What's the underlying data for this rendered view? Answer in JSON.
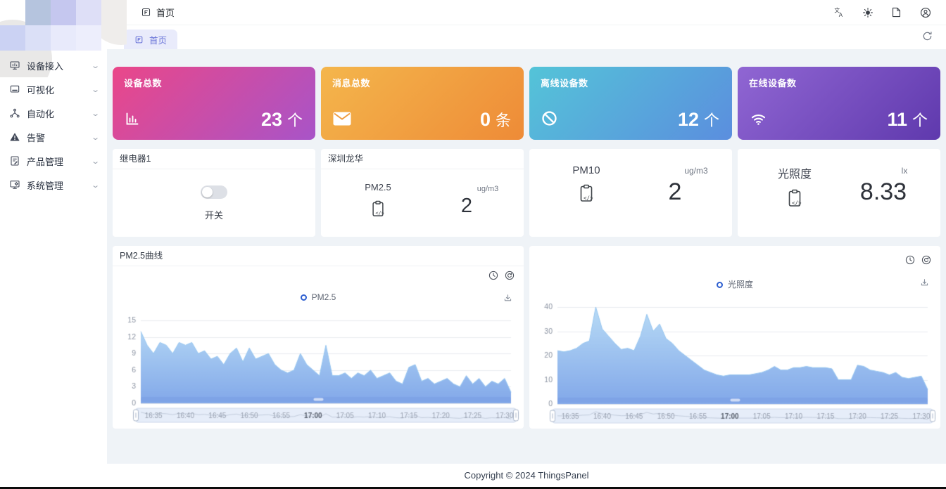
{
  "header": {
    "breadcrumb_label": "首页"
  },
  "tabbar": {
    "active_tab_label": "首页"
  },
  "sidebar": {
    "items": [
      {
        "label": "设备接入",
        "icon": "device-access-icon"
      },
      {
        "label": "可视化",
        "icon": "visualization-icon"
      },
      {
        "label": "自动化",
        "icon": "automation-icon"
      },
      {
        "label": "告警",
        "icon": "alarm-icon"
      },
      {
        "label": "产品管理",
        "icon": "product-management-icon"
      },
      {
        "label": "系统管理",
        "icon": "system-management-icon"
      }
    ]
  },
  "stats": [
    {
      "title": "设备总数",
      "value": "23",
      "unit": "个",
      "icon": "bar-chart-icon",
      "gradient": [
        "#ea4789",
        "#a854c8"
      ]
    },
    {
      "title": "消息总数",
      "value": "0",
      "unit": "条",
      "icon": "mail-icon",
      "gradient": [
        "#f4b64c",
        "#ee8b37"
      ]
    },
    {
      "title": "离线设备数",
      "value": "12",
      "unit": "个",
      "icon": "ban-icon",
      "gradient": [
        "#54c4d8",
        "#5b8ede"
      ]
    },
    {
      "title": "在线设备数",
      "value": "11",
      "unit": "个",
      "icon": "wifi-icon",
      "gradient": [
        "#9066d3",
        "#5f39ad"
      ]
    }
  ],
  "widgets": {
    "relay": {
      "title": "继电器1",
      "switch_label": "开关",
      "switch_on": false
    },
    "shenzhen": {
      "title": "深圳龙华",
      "metric": "PM2.5",
      "value": "2",
      "unit": "ug/m3"
    },
    "pm10": {
      "metric": "PM10",
      "value": "2",
      "unit": "ug/m3"
    },
    "illuminance": {
      "metric": "光照度",
      "value": "8.33",
      "unit": "lx"
    }
  },
  "chart_data": [
    {
      "type": "area",
      "title": "PM2.5曲线",
      "legend": "PM2.5",
      "legend_position": "top-center",
      "unit": "ug/m3",
      "grid": true,
      "x_start": "16:33",
      "x_end": "17:31",
      "x_ticks": [
        "16:35",
        "16:40",
        "16:45",
        "16:50",
        "16:55",
        "17:00",
        "17:05",
        "17:10",
        "17:15",
        "17:20",
        "17:25",
        "17:30"
      ],
      "bold_tick": "17:00",
      "ylim": [
        0,
        15
      ],
      "yticks": [
        0,
        3,
        6,
        9,
        12,
        15
      ],
      "values": [
        13,
        10.5,
        9,
        11,
        10.5,
        9,
        11,
        10.5,
        11,
        9,
        9.5,
        8,
        8.5,
        7,
        9,
        10,
        7.5,
        10,
        8,
        8.5,
        9,
        7,
        6,
        5.5,
        6,
        9,
        7,
        6,
        5,
        10.5,
        5,
        5,
        5.5,
        4.5,
        5.5,
        5,
        6,
        4.5,
        5,
        5.5,
        4,
        3.5,
        6.5,
        7,
        4,
        4.5,
        3.5,
        4,
        4.5,
        3.5,
        3,
        5,
        3.5,
        4.5,
        3,
        4,
        3.5,
        4.5,
        2
      ],
      "colors": {
        "area_top": "#b8dbf6",
        "area_bottom": "#82a8e9",
        "line": "#93c4ef",
        "band": "#7ea3e6"
      }
    },
    {
      "type": "area",
      "title": "",
      "legend": "光照度",
      "legend_position": "top-center",
      "unit": "lx",
      "grid": true,
      "x_start": "16:33",
      "x_end": "17:31",
      "x_ticks": [
        "16:35",
        "16:40",
        "16:45",
        "16:50",
        "16:55",
        "17:00",
        "17:05",
        "17:10",
        "17:15",
        "17:20",
        "17:25",
        "17:30"
      ],
      "bold_tick": "17:00",
      "ylim": [
        0,
        40
      ],
      "yticks": [
        0,
        10,
        20,
        30,
        40
      ],
      "values": [
        22,
        21.5,
        22,
        23,
        25,
        26,
        40,
        31,
        28,
        25,
        22.5,
        23,
        22,
        28,
        37,
        30,
        33,
        27,
        25,
        22,
        20,
        18,
        16,
        14,
        13,
        12,
        11.5,
        12,
        12,
        12,
        12,
        12.5,
        13,
        14,
        15.5,
        14,
        14,
        15,
        15,
        15.5,
        15,
        15,
        15,
        14.5,
        10,
        10,
        10,
        16,
        15.5,
        14,
        13.5,
        13,
        12,
        13,
        11,
        10.5,
        11,
        11.5,
        6
      ],
      "colors": {
        "area_top": "#b8dbf6",
        "area_bottom": "#82a8e9",
        "line": "#93c4ef",
        "band": "#7ea3e6"
      }
    }
  ],
  "footer": {
    "copyright": "Copyright © 2024 ThingsPanel"
  }
}
